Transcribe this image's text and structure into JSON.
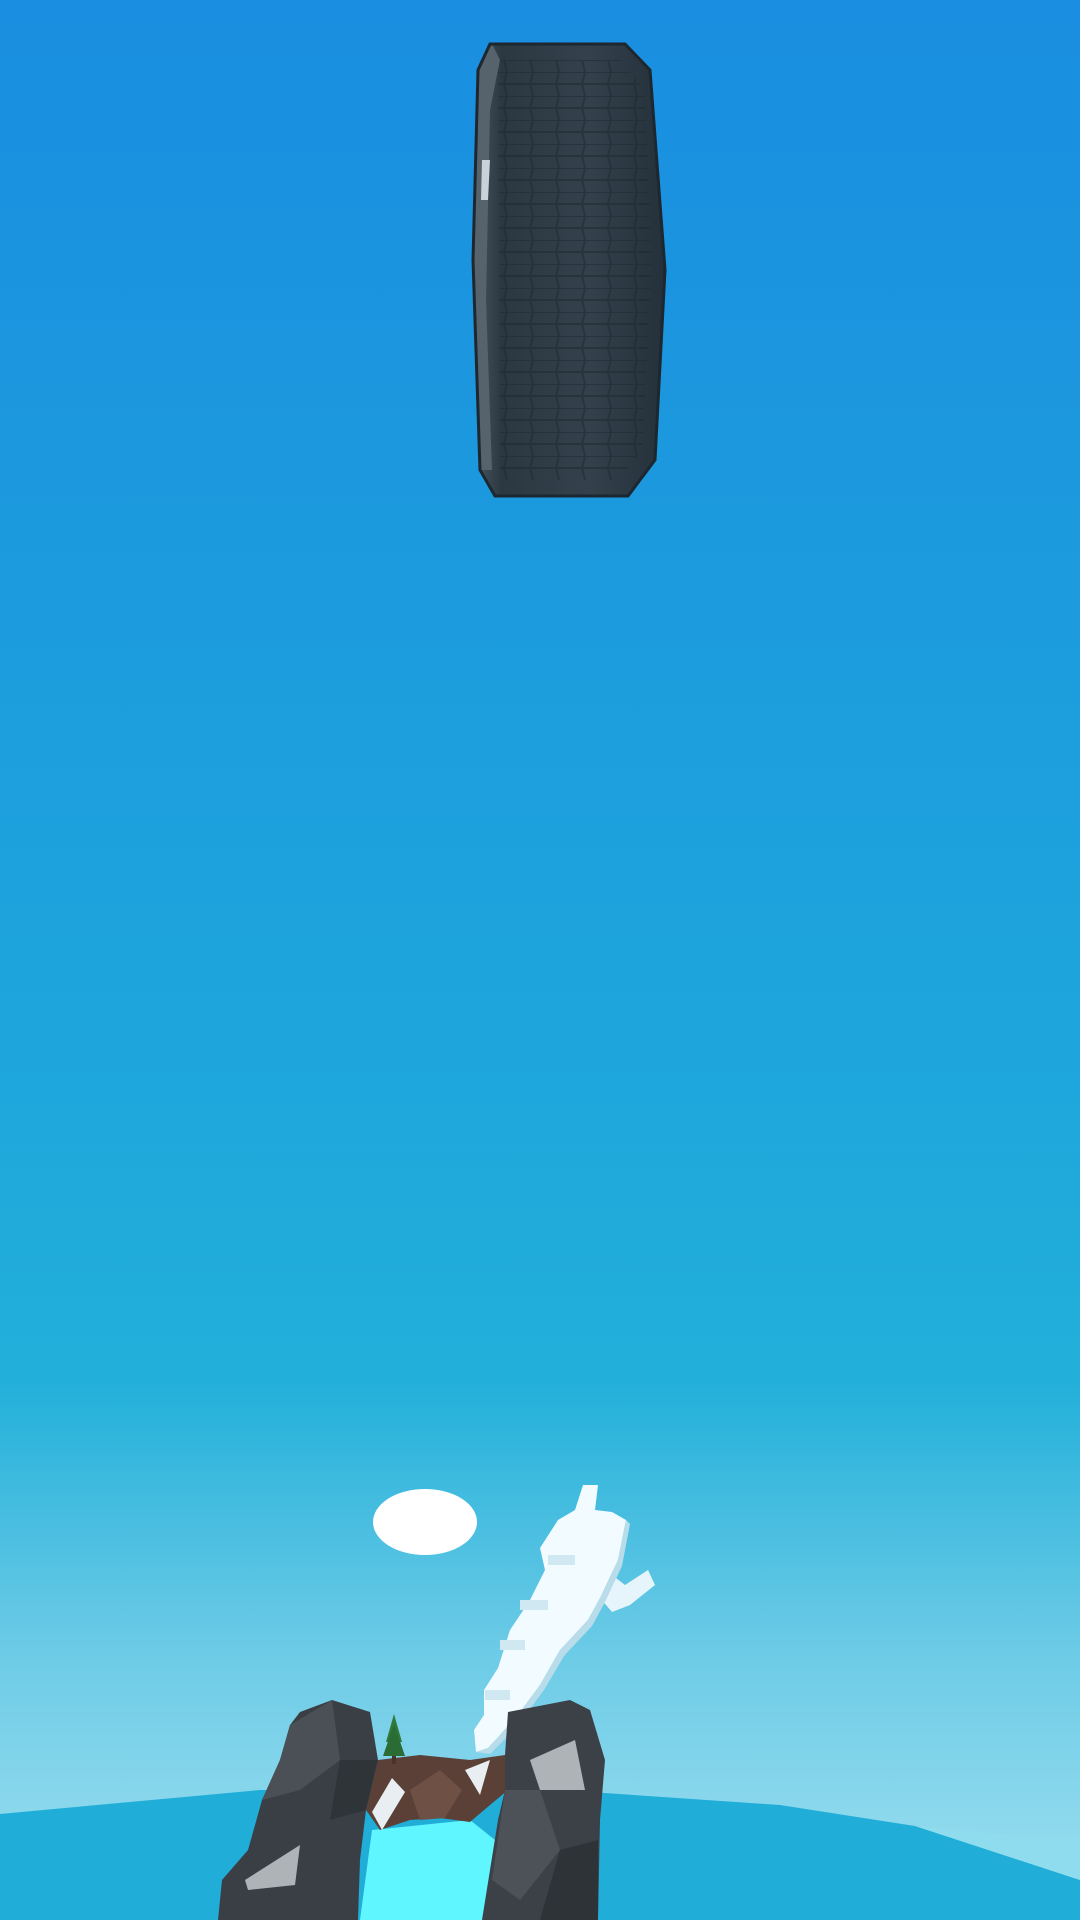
{
  "scene": {
    "sky_top_color": "#1a8ee0",
    "sky_mid_color": "#1ea8dc",
    "sky_bottom_color": "#8fd9ee",
    "sea_color": "#20aed8",
    "sea_light_color": "#8fdcee",
    "pool_color": "#5ff6ff",
    "rock_dark_color": "#3a3f45",
    "rock_light_color": "#5c6268",
    "rock_highlight_color": "#aeb3b8",
    "dirt_color": "#5a4036",
    "tree_color": "#2f7a3a",
    "cloud_color": "#ffffff",
    "tire_color": "#2e3a44",
    "objects": [
      {
        "name": "tire",
        "icon": "tire-icon"
      },
      {
        "name": "cloud",
        "icon": "cloud-icon"
      },
      {
        "name": "jet",
        "icon": "jet-icon"
      },
      {
        "name": "rock-arch",
        "icon": "rock-arch-icon"
      },
      {
        "name": "pine-tree",
        "icon": "tree-icon"
      }
    ]
  }
}
